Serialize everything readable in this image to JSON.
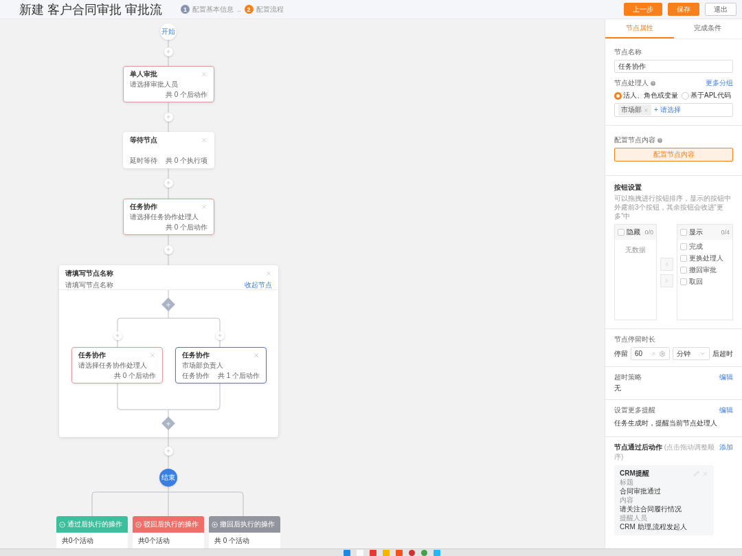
{
  "header": {
    "title": "新建 客户合同审批 审批流",
    "steps": [
      {
        "number": "1",
        "label": "配置基本信息",
        "selected": false
      },
      {
        "number": "2",
        "label": "配置流程",
        "selected": true
      }
    ],
    "step_separator": "..",
    "buttons": [
      {
        "label": "上一步",
        "kind": "primary"
      },
      {
        "label": "保存",
        "kind": "primary"
      },
      {
        "label": "退出",
        "kind": "default"
      }
    ]
  },
  "flow": {
    "start": "开始",
    "end": "结束",
    "nodes": [
      {
        "title": "单人审批",
        "subtitle": "请选择审批人员",
        "count": "共 0 个后动作",
        "invalid": true,
        "selected": false
      },
      {
        "title": "等待节点",
        "note": "延时等待",
        "count": "共 0 个执行项",
        "invalid": false,
        "selected": false
      },
      {
        "title": "任务协作",
        "subtitle": "请选择任务协作处理人",
        "count": "共 0 个后动作",
        "invalid": true,
        "selected": false
      }
    ],
    "group": {
      "title": "请填写节点名称",
      "subtitle": "请填写节点名称",
      "link": "收起节点",
      "branches": [
        {
          "title": "任务协作",
          "subtitle": "请选择任务协作处理人",
          "count": "共 0 个后动作",
          "invalid": true,
          "selected": false
        },
        {
          "title": "任务协作",
          "subtitle": "市场部负责人",
          "note": "任务协作",
          "count": "共 1 个后动作",
          "invalid": false,
          "selected": true
        }
      ]
    },
    "outcomes": [
      {
        "label": "通过后执行的操作",
        "count": "共0个活动",
        "kind": "pass"
      },
      {
        "label": "驳回后执行的操作",
        "count": "共0个活动",
        "kind": "reject"
      },
      {
        "label": "撤回后执行的操作",
        "count": "共 0 个活动",
        "kind": "withdraw"
      }
    ]
  },
  "panel": {
    "tabs": [
      {
        "label": "节点属性",
        "selected": true
      },
      {
        "label": "完成条件",
        "selected": false
      }
    ],
    "node_name": {
      "label": "节点名称",
      "value": "任务协作"
    },
    "handler": {
      "label": "节点处理人",
      "link": "更多分组",
      "options": [
        {
          "label": "活人、角色或变量",
          "selected": true
        },
        {
          "label": "基于APL代码",
          "selected": false
        }
      ],
      "tags": [
        "市场部"
      ],
      "add": "+ 请选择"
    },
    "content": {
      "label": "配置节点内容",
      "button": "配置节点内容"
    },
    "button_settings": {
      "title": "按钮设置",
      "description": "可以拖拽进行按钮排序，显示的按钮中外露前3个按钮，其余按钮会收进“更多”中",
      "hidden": {
        "label": "隐藏",
        "count": "0/0",
        "checked": false,
        "empty": "无数据"
      },
      "shown": {
        "label": "显示",
        "count": "0/4",
        "checked": false,
        "items": [
          {
            "label": "完成",
            "checked": false
          },
          {
            "label": "更换处理人",
            "checked": false
          },
          {
            "label": "撤回审批",
            "checked": false
          },
          {
            "label": "取回",
            "checked": false
          }
        ]
      }
    },
    "stay": {
      "label": "节点停留时长",
      "prefix": "停留",
      "value": "60",
      "unit": "分钟",
      "suffix": "后超时"
    },
    "timeout": {
      "label": "超时策略",
      "link": "编辑",
      "value": "无"
    },
    "reminder": {
      "label": "设置更多提醒",
      "link": "编辑",
      "value": "任务生成时，提醒当前节点处理人"
    },
    "actions": {
      "label": "节点通过后动作",
      "hint": "(点击拖动调整顺序)",
      "link": "添加",
      "cards": [
        {
          "title": "CRM提醒",
          "fields": [
            {
              "label": "标题",
              "value": "合同审批通过"
            },
            {
              "label": "内容",
              "value": "请关注合同履行情况"
            },
            {
              "label": "提醒人员",
              "value": "CRM 助理,流程发起人"
            }
          ]
        }
      ]
    }
  }
}
